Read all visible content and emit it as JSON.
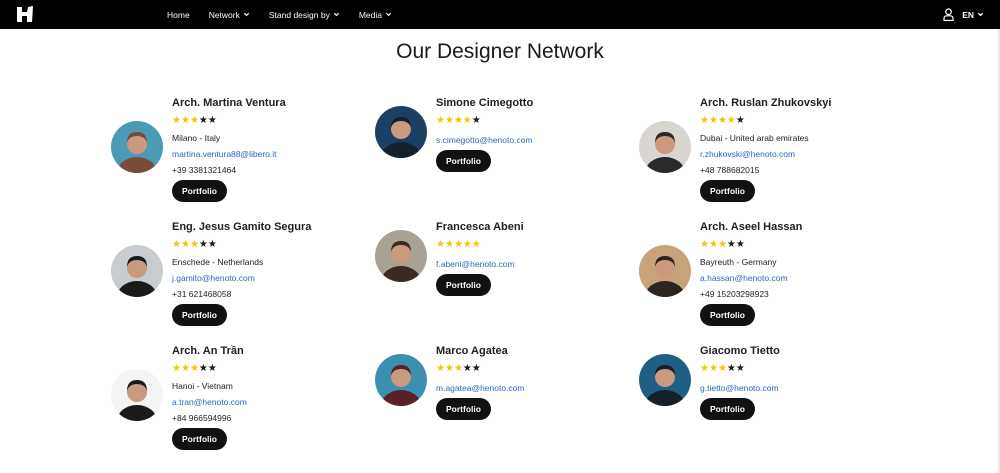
{
  "nav": {
    "logo_icon": "henoto-logo-icon",
    "items": [
      {
        "label": "Home",
        "dropdown": false
      },
      {
        "label": "Network",
        "dropdown": true
      },
      {
        "label": "Stand design by",
        "dropdown": true
      },
      {
        "label": "Media",
        "dropdown": true
      }
    ],
    "user_icon": "user-icon",
    "language": "EN"
  },
  "page_title": "Our Designer Network",
  "colors": {
    "topbar": "#000000",
    "star_on": "#f2c500",
    "star_off": "#1a1a1a",
    "link": "#2a67c0",
    "button": "#111111"
  },
  "designers": [
    {
      "name": "Arch. Martina Ventura",
      "rating": 3,
      "location": "Milano - Italy",
      "email": "martina.ventura88@libero.it",
      "phone": "+39 3381321464",
      "button": "Portfolio",
      "avatar_bg": "#4a9bb8",
      "avatar_fg": "#7a4a3a"
    },
    {
      "name": "Simone Cimegotto",
      "rating": 4,
      "location": "",
      "email": "s.cimegotto@henoto.com",
      "phone": "",
      "button": "Portfolio",
      "avatar_bg": "#1d3f63",
      "avatar_fg": "#14202c"
    },
    {
      "name": "Arch. Ruslan Zhukovskyi",
      "rating": 4,
      "location": "Dubai - United arab emirates",
      "email": "r.zhukovski@henoto.com",
      "phone": "+48 788682015",
      "button": "Portfolio",
      "avatar_bg": "#d9d6d2",
      "avatar_fg": "#2a2a2a"
    },
    {
      "name": "Eng. Jesus Gamito Segura",
      "rating": 3,
      "location": "Enschede - Netherlands",
      "email": "j.gamito@henoto.com",
      "phone": "+31 621468058",
      "button": "Portfolio",
      "avatar_bg": "#c8ccd0",
      "avatar_fg": "#1a1a1a"
    },
    {
      "name": "Francesca Abeni",
      "rating": 5,
      "location": "",
      "email": "f.abeni@henoto.com",
      "phone": "",
      "button": "Portfolio",
      "avatar_bg": "#a8a295",
      "avatar_fg": "#3a2a22"
    },
    {
      "name": "Arch. Aseel Hassan",
      "rating": 3,
      "location": "Bayreuth - Germany",
      "email": "a.hassan@henoto.com",
      "phone": "+49 15203298923",
      "button": "Portfolio",
      "avatar_bg": "#c9a27a",
      "avatar_fg": "#2b2420"
    },
    {
      "name": "Arch. An Trần",
      "rating": 3,
      "location": "Hanoi - Vietnam",
      "email": "a.tran@henoto.com",
      "phone": "+84 966594996",
      "button": "Portfolio",
      "avatar_bg": "#f4f4f4",
      "avatar_fg": "#1a1a1a"
    },
    {
      "name": "Marco Agatea",
      "rating": 3,
      "location": "",
      "email": "m.agatea@henoto.com",
      "phone": "",
      "button": "Portfolio",
      "avatar_bg": "#3d8fb0",
      "avatar_fg": "#5a2228"
    },
    {
      "name": "Giacomo Tietto",
      "rating": 3,
      "location": "",
      "email": "g.tietto@henoto.com",
      "phone": "",
      "button": "Portfolio",
      "avatar_bg": "#1f5f86",
      "avatar_fg": "#15202a"
    }
  ]
}
